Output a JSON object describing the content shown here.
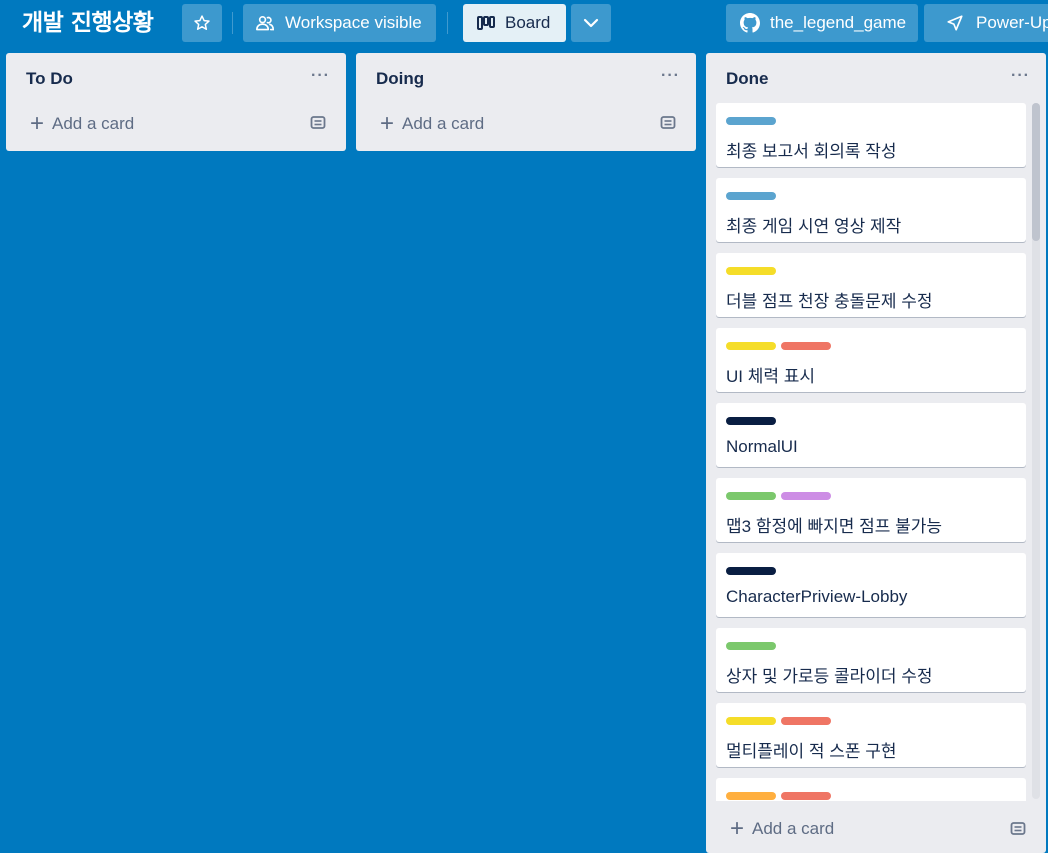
{
  "header": {
    "board_title": "개발 진행상황",
    "workspace_label": "Workspace visible",
    "board_view_label": "Board",
    "github_label": "the_legend_game",
    "powerups_label": "Power-Ups"
  },
  "lists": [
    {
      "title": "To Do",
      "menu": "···",
      "add_card": "Add a card"
    },
    {
      "title": "Doing",
      "menu": "···",
      "add_card": "Add a card"
    },
    {
      "title": "Done",
      "menu": "···",
      "add_card": "Add a card"
    }
  ],
  "done_cards": [
    {
      "title": "최종 보고서 회의록 작성",
      "labels": [
        "#5ba4cf"
      ]
    },
    {
      "title": "최종 게임 시연 영상 제작",
      "labels": [
        "#5ba4cf"
      ]
    },
    {
      "title": "더블 점프 천장 충돌문제 수정",
      "labels": [
        "#f5dd29"
      ]
    },
    {
      "title": "UI 체력 표시",
      "labels": [
        "#f5dd29",
        "#ef7564"
      ]
    },
    {
      "title": "NormalUI",
      "labels": [
        "#091e42"
      ]
    },
    {
      "title": "맵3 함정에 빠지면 점프 불가능",
      "labels": [
        "#7bc86c",
        "#cd8de5"
      ]
    },
    {
      "title": "CharacterPriview-Lobby",
      "labels": [
        "#091e42"
      ]
    },
    {
      "title": "상자 및 가로등 콜라이더 수정",
      "labels": [
        "#7bc86c"
      ]
    },
    {
      "title": "멀티플레이 적 스폰 구현",
      "labels": [
        "#f5dd29",
        "#ef7564"
      ]
    },
    {
      "title": "",
      "labels": [
        "#ffaf3f",
        "#ef7564"
      ]
    }
  ],
  "colors": {
    "board_background": "#0079bf",
    "list_background": "#ebecf0",
    "card_background": "#ffffff"
  }
}
